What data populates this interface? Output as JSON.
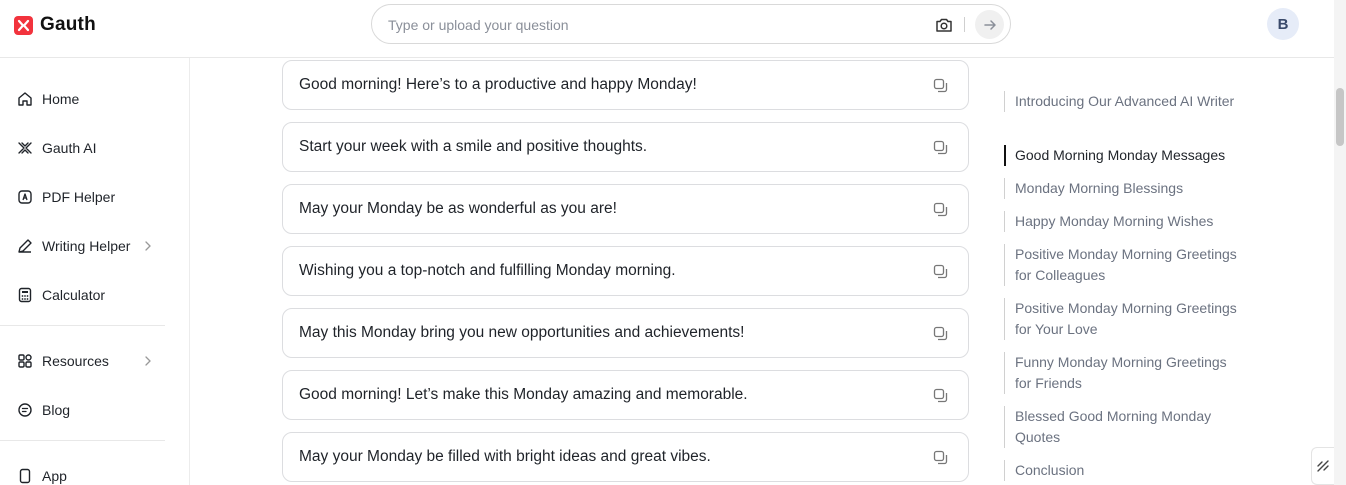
{
  "header": {
    "logo_text": "Gauth",
    "search_placeholder": "Type or upload your question",
    "avatar_initial": "B"
  },
  "sidebar": {
    "items": [
      {
        "label": "Home",
        "icon": "home-icon"
      },
      {
        "label": "Gauth AI",
        "icon": "gauth-ai-icon"
      },
      {
        "label": "PDF Helper",
        "icon": "pdf-icon"
      },
      {
        "label": "Writing Helper",
        "icon": "pen-icon",
        "has_submenu": true
      },
      {
        "label": "Calculator",
        "icon": "calculator-icon"
      },
      {
        "label": "Resources",
        "icon": "grid-icon",
        "has_submenu": true
      },
      {
        "label": "Blog",
        "icon": "blog-icon"
      },
      {
        "label": "App",
        "icon": "phone-icon"
      }
    ]
  },
  "messages": [
    "Good morning! Here’s to a productive and happy Monday!",
    "Start your week with a smile and positive thoughts.",
    "May your Monday be as wonderful as you are!",
    "Wishing you a top-notch and fulfilling Monday morning.",
    "May this Monday bring you new opportunities and achievements!",
    "Good morning! Let’s make this Monday amazing and memorable.",
    "May your Monday be filled with bright ideas and great vibes."
  ],
  "toc": {
    "active_index": 1,
    "items": [
      "Introducing Our Advanced AI Writer",
      "Good Morning Monday Messages",
      "Monday Morning Blessings",
      "Happy Monday Morning Wishes",
      "Positive Monday Morning Greetings for Colleagues",
      "Positive Monday Morning Greetings for Your Love",
      "Funny Monday Morning Greetings for Friends",
      "Blessed Good Morning Monday Quotes",
      "Conclusion"
    ]
  },
  "colors": {
    "brand": "#f2333d",
    "border": "#dcdde0",
    "muted_text": "#6b7280"
  }
}
